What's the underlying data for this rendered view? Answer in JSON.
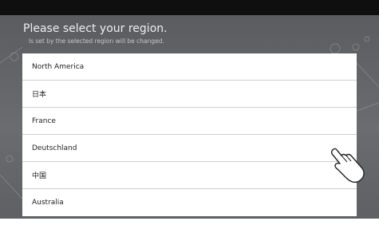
{
  "header": {
    "title": "Please select your region.",
    "subtitle": "ls set by the selected region will be changed."
  },
  "regions": [
    {
      "label": "North America"
    },
    {
      "label": "日本"
    },
    {
      "label": "France"
    },
    {
      "label": "Deutschland"
    },
    {
      "label": "中国"
    },
    {
      "label": "Australia"
    }
  ],
  "pointer": {
    "icon": "hand-pointer-icon"
  }
}
